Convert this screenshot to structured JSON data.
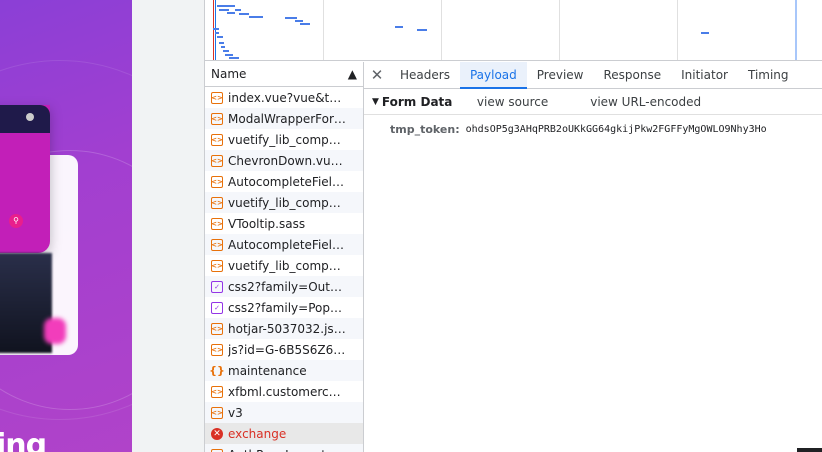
{
  "page_preview": {
    "hero_text": "ing"
  },
  "devtools": {
    "list": {
      "header": "Name",
      "rows": [
        {
          "name": "index.vue?vue&type...",
          "type": "script"
        },
        {
          "name": "ModalWrapperForE...",
          "type": "script"
        },
        {
          "name": "vuetify_lib_compon...",
          "type": "script"
        },
        {
          "name": "ChevronDown.vue?...",
          "type": "script"
        },
        {
          "name": "AutocompleteField....",
          "type": "script"
        },
        {
          "name": "vuetify_lib_compon...",
          "type": "script"
        },
        {
          "name": "VTooltip.sass",
          "type": "script"
        },
        {
          "name": "AutocompleteField....",
          "type": "script"
        },
        {
          "name": "vuetify_lib_compon...",
          "type": "script"
        },
        {
          "name": "css2?family=Outfit:...",
          "type": "stylesheet"
        },
        {
          "name": "css2?family=Poppin...",
          "type": "stylesheet"
        },
        {
          "name": "hotjar-5037032.js?s...",
          "type": "script"
        },
        {
          "name": "js?id=G-6B5S6Z67Q...",
          "type": "script"
        },
        {
          "name": "maintenance",
          "type": "json"
        },
        {
          "name": "xfbml.customerchat.js",
          "type": "script"
        },
        {
          "name": "v3",
          "type": "script"
        },
        {
          "name": "exchange",
          "type": "error"
        },
        {
          "name": "AuthPageLayout.vu...",
          "type": "script"
        }
      ]
    },
    "tabs": [
      "Headers",
      "Payload",
      "Preview",
      "Response",
      "Initiator",
      "Timing"
    ],
    "active_tab": "Payload",
    "payload": {
      "section_title": "Form Data",
      "view_source": "view source",
      "view_url_encoded": "view URL-encoded",
      "key": "tmp_token:",
      "value": "ohdsOP5g3AHqPRB2oUKkGG64gkijPkw2FGFFyMgOWLO9Nhy3Ho"
    }
  },
  "colors": {
    "accent": "#1a73e8",
    "error": "#d93025",
    "script_icon": "#e8710a",
    "css_icon": "#9334e6",
    "page_gradient_start": "#8b3fd6",
    "page_gradient_end": "#b043c9"
  }
}
